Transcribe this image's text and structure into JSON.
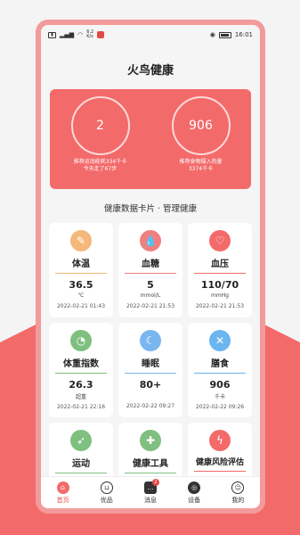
{
  "status": {
    "speed": "6.2\nK/s",
    "time": "16:01"
  },
  "app": {
    "title": "火鸟健康"
  },
  "hero": {
    "left": {
      "value": "2",
      "caption1": "推荐运动能耗334千卡",
      "caption2": "今天走了67步"
    },
    "right": {
      "value": "906",
      "caption1": "推荐食物摄入热量",
      "caption2": "3374千卡"
    }
  },
  "section_title": "健康数据卡片 · 管理健康",
  "cards": [
    {
      "name": "体温",
      "value": "36.5",
      "unit": "℃",
      "date": "2022-02-21 01:43",
      "color": "#f3b87a",
      "bar": "#f3b87a"
    },
    {
      "name": "血糖",
      "value": "5",
      "unit": "mmol/L",
      "date": "2022-02-21 21:53",
      "color": "#f08080",
      "bar": "#f08080"
    },
    {
      "name": "血压",
      "value": "110/70",
      "unit": "mmHg",
      "date": "2022-02-21 21:53",
      "color": "#f36a6a",
      "bar": "#f36a6a"
    },
    {
      "name": "体重指数",
      "value": "26.3",
      "unit": "超重",
      "date": "2022-02-21 22:16",
      "color": "#7fbf7f",
      "bar": "#7fbf7f"
    },
    {
      "name": "睡眠",
      "value": "80+",
      "unit": "",
      "date": "2022-02-22 09:27",
      "color": "#7ab6f0",
      "bar": "#7ab6f0"
    },
    {
      "name": "膳食",
      "value": "906",
      "unit": "千卡",
      "date": "2022-02-22 09:26",
      "color": "#6cb6f0",
      "bar": "#6cb6f0"
    },
    {
      "name": "运动",
      "color": "#7fbf7f",
      "bar": "#7fbf7f"
    },
    {
      "name": "健康工具",
      "color": "#7fbf7f",
      "bar": "#7fbf7f"
    },
    {
      "name": "健康风险评估",
      "color": "#f36a6a",
      "bar": "#f36a6a"
    }
  ],
  "tabs": [
    {
      "label": "首页",
      "icon": "home-icon"
    },
    {
      "label": "优品",
      "icon": "basket-icon"
    },
    {
      "label": "消息",
      "icon": "message-icon",
      "badge": "2"
    },
    {
      "label": "设备",
      "icon": "device-icon"
    },
    {
      "label": "我的",
      "icon": "user-icon"
    }
  ]
}
